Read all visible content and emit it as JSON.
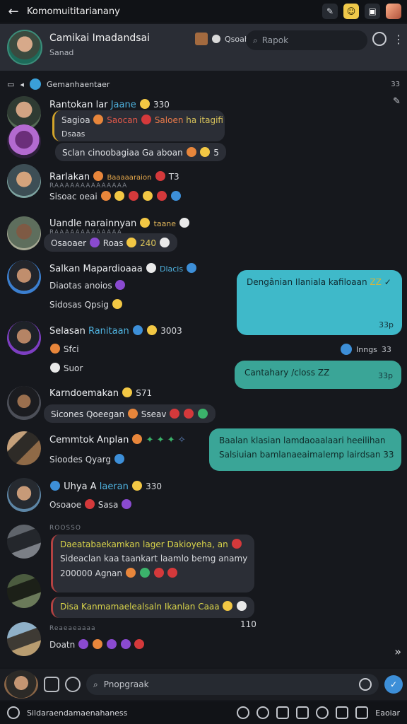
{
  "window": {
    "title": "Komomuititarianany"
  },
  "header": {
    "channel_name": "Camikai Imadandsai",
    "channel_sub": "Sanad",
    "mini_label": "Qsoab",
    "search_placeholder": "Rapok"
  },
  "pinned": {
    "label": "Gemanhaentaer",
    "count": "33"
  },
  "messages": [
    {
      "name": "Rantokan lar",
      "name_hl": "Jaane",
      "meta": "330",
      "line1": "Sagioa",
      "line1_b": "Saocan",
      "line1_c": "Saloen",
      "line1_d": "ha itagifi",
      "line2": "Dsaas"
    },
    {
      "line": "Sclan cinoobagiaa Ga aboan",
      "meta": "5"
    },
    {
      "name": "Rarlakan",
      "name_b": "Baaaaaraion",
      "meta": "T3",
      "sub": "RAAAAAAAAAAAAAA",
      "line": "Sisoac oeai"
    },
    {
      "name": "Uandle narainnyan",
      "name_b": "taane",
      "sub": "RAAAAAAAAAAAAA",
      "line": "Osaoaer",
      "line_b": "Roas",
      "line_c": "240"
    },
    {
      "name": "Salkan Mapardioaaa",
      "name_hl": "Dlacis",
      "line1": "Diaotas",
      "line1_b": "anoios",
      "line2": "Sidosas Qpsig"
    },
    {
      "name": "Selasan",
      "name_hl": "Ranitaan",
      "meta": "3003",
      "line1": "Sfci",
      "line2": "Suor"
    },
    {
      "name": "Karndoemakan",
      "meta": "S71",
      "line": "Sicones Qoeegan",
      "line_b": "Sseav"
    },
    {
      "name": "Cemmtok Anplan",
      "line": "Sioodes Qyarg"
    },
    {
      "name": "Uhya A",
      "name_hl": "laeran",
      "meta": "330",
      "line": "Osoaoe",
      "line_b": "Sasa"
    },
    {
      "head": "ROOSSO",
      "quote1": "Daeatabaekamkan lager Dakioyeha, an",
      "quote2": "Sideaclan kaa taankart laamlo bemg anamy",
      "quote3": "200000 Agnan"
    },
    {
      "quote_b": "Disa Kanmamaelealsaln Ikanlan Caaa",
      "meta": "110"
    },
    {
      "sub": "Reaeaeaaaa",
      "line": "Doatn"
    }
  ],
  "outgoing": [
    {
      "text": "Dengânian Ilaniala kafiloaan",
      "mark": "ZZ",
      "time": "33p"
    },
    {
      "read_text": "Inngs",
      "read_num": "33"
    },
    {
      "text": "Cantahary /closs",
      "mark": "ZZ",
      "time": "33p"
    },
    {
      "text1": "Baalan klasian lamdaoaalaari heeilihan",
      "text2": "Salsiuian bamlanaeaimalemp lairdsan",
      "num": "33"
    }
  ],
  "composer": {
    "placeholder": "Pnopgraak"
  },
  "bottombar": {
    "label": "Sildaraendamaenahaness",
    "right": "Eaoiar"
  }
}
